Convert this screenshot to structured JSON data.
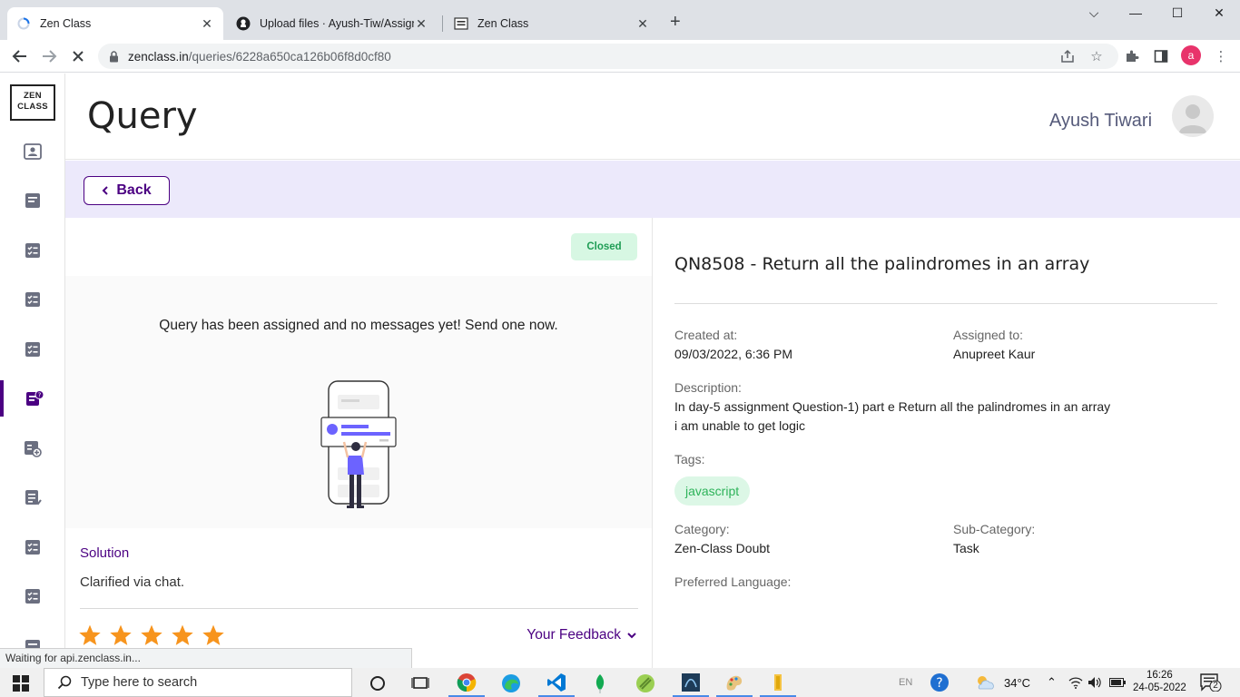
{
  "browser": {
    "tabs": [
      {
        "title": "Zen Class",
        "active": true
      },
      {
        "title": "Upload files · Ayush-Tiw/Assignm",
        "active": false
      },
      {
        "title": "Zen Class",
        "active": false
      }
    ],
    "url_host": "zenclass.in",
    "url_path": "/queries/6228a650ca126b06f8d0cf80",
    "profile_initial": "a"
  },
  "sidebar": {
    "logo_line1": "ZEN",
    "logo_line2": "CLASS",
    "items": [
      "dashboard-icon",
      "class-icon",
      "tasks-icon",
      "webcode-icon",
      "capstone-icon",
      "queries-icon",
      "requirements-icon",
      "portfolio-icon",
      "applications-icon",
      "interview-icon",
      "certificate-icon"
    ],
    "active_index": 5
  },
  "header": {
    "title": "Query",
    "user_name": "Ayush Tiwari"
  },
  "back_label": "Back",
  "left_panel": {
    "status": "Closed",
    "chat_message": "Query has been assigned and no messages yet! Send one now.",
    "solution_label": "Solution",
    "solution_text": "Clarified via chat.",
    "rating": 5,
    "feedback_label": "Your Feedback"
  },
  "query": {
    "title": "QN8508 - Return all the palindromes in an array",
    "created_label": "Created at:",
    "created_value": "09/03/2022, 6:36 PM",
    "assigned_label": "Assigned to:",
    "assigned_value": "Anupreet Kaur",
    "description_label": "Description:",
    "description_line1": "In day-5 assignment Question-1) part e Return all the palindromes in an array",
    "description_line2": "i am unable to get logic",
    "tags_label": "Tags:",
    "tags": [
      "javascript"
    ],
    "category_label": "Category:",
    "category_value": "Zen-Class Doubt",
    "subcategory_label": "Sub-Category:",
    "subcategory_value": "Task",
    "language_label": "Preferred Language:"
  },
  "status_bar": "Waiting for api.zenclass.in...",
  "taskbar": {
    "search_placeholder": "Type here to search",
    "lang": "EN",
    "temperature": "34°C",
    "time": "16:26",
    "date": "24-05-2022",
    "notifications": "2"
  },
  "colors": {
    "accent": "#4b0082",
    "back_bar": "#ece9fb",
    "status_closed_bg": "#d7f7e3",
    "star": "#f7941d"
  }
}
